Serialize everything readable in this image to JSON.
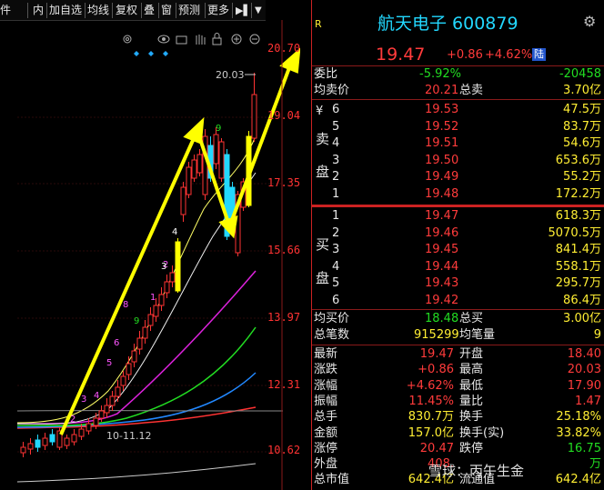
{
  "toolbar": {
    "items": [
      "件",
      "内",
      "加自选",
      "均线",
      "复权",
      "叠",
      "窗",
      "预测",
      "更多"
    ],
    "expand_icon": "expand-right-icon",
    "dropdown_icon": "chevron-down-icon"
  },
  "chart_icons": [
    "settings-icon",
    "eye-icon",
    "basket-icon",
    "hand-icon",
    "lock-icon",
    "zoom-in-icon",
    "zoom-out-icon"
  ],
  "chart": {
    "price_labels": [
      "20.70",
      "19.04",
      "17.35",
      "15.66",
      "13.97",
      "12.31",
      "10.62"
    ],
    "high_label": "20.03",
    "date_range": "10-11.12",
    "count_labels": [
      "2",
      "3",
      "4",
      "5",
      "6",
      "8",
      "1",
      "2",
      "9",
      "3",
      "4",
      "8",
      "9"
    ],
    "colors": {
      "up": "#ff3333",
      "down": "#22d8ff",
      "limit": "#ffff00",
      "arrow": "#ffff00"
    }
  },
  "header": {
    "r_badge": "R",
    "title": "航天电子 600879",
    "settings_icon": "gear-icon"
  },
  "quote": {
    "price": "19.47",
    "change": "+0.86",
    "pct": "+4.62%",
    "market_badge": "陆"
  },
  "weibi": {
    "label": "委比",
    "ratio": "-5.92%",
    "diff": "-20458"
  },
  "avg_sell": {
    "label": "均卖价",
    "price": "20.21",
    "total_label": "总卖",
    "total": "3.70亿"
  },
  "sell_side_label": [
    "¥",
    "卖",
    "盘"
  ],
  "sells": [
    {
      "level": "6",
      "price": "19.53",
      "vol": "47.5万"
    },
    {
      "level": "5",
      "price": "19.52",
      "vol": "83.7万"
    },
    {
      "level": "4",
      "price": "19.51",
      "vol": "54.6万"
    },
    {
      "level": "3",
      "price": "19.50",
      "vol": "653.6万"
    },
    {
      "level": "2",
      "price": "19.49",
      "vol": "55.2万"
    },
    {
      "level": "1",
      "price": "19.48",
      "vol": "172.2万"
    }
  ],
  "buy_side_label": [
    "买",
    "盘"
  ],
  "buys": [
    {
      "level": "1",
      "price": "19.47",
      "vol": "618.3万"
    },
    {
      "level": "2",
      "price": "19.46",
      "vol": "5070.5万"
    },
    {
      "level": "3",
      "price": "19.45",
      "vol": "841.4万"
    },
    {
      "level": "4",
      "price": "19.44",
      "vol": "558.1万"
    },
    {
      "level": "5",
      "price": "19.43",
      "vol": "295.7万"
    },
    {
      "level": "6",
      "price": "19.42",
      "vol": "86.4万"
    }
  ],
  "avg_buy": {
    "label": "均买价",
    "price": "18.48",
    "total_label": "总买",
    "total": "3.00亿"
  },
  "per_trade": {
    "label": "总笔数",
    "value": "915299",
    "label2": "均笔量",
    "value2": "9"
  },
  "stats": [
    {
      "l1": "最新",
      "v1": "19.47",
      "l2": "开盘",
      "v2": "18.40"
    },
    {
      "l1": "涨跌",
      "v1": "+0.86",
      "l2": "最高",
      "v2": "20.03"
    },
    {
      "l1": "涨幅",
      "v1": "+4.62%",
      "l2": "最低",
      "v2": "17.90"
    },
    {
      "l1": "振幅",
      "v1": "11.45%",
      "l2": "量比",
      "v2": "1.47"
    },
    {
      "l1": "总手",
      "v1": "830.7万",
      "l2": "换手",
      "v2": "25.18%"
    },
    {
      "l1": "金额",
      "v1": "157.0亿",
      "l2": "换手(实)",
      "v2": "33.82%"
    },
    {
      "l1": "涨停",
      "v1": "20.47",
      "l2": "跌停",
      "v2": "16.75"
    },
    {
      "l1": "外盘",
      "v1": "408.",
      "l2": "",
      "v2": "万"
    },
    {
      "l1": "总市值",
      "v1": "642.4亿",
      "l2": "流通值",
      "v2": "642.4亿"
    }
  ],
  "watermark": "雪球：丙午生金"
}
